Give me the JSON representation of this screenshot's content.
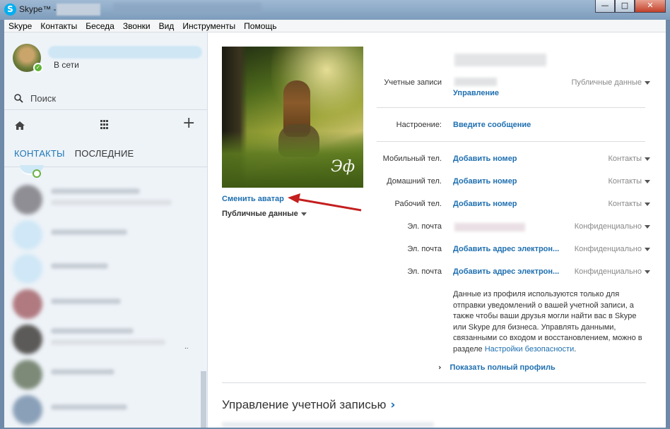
{
  "window": {
    "title": "Skype™ -",
    "logo_letter": "S",
    "controls": [
      "—",
      "□",
      "✕"
    ]
  },
  "menu": [
    "Skype",
    "Контакты",
    "Беседа",
    "Звонки",
    "Вид",
    "Инструменты",
    "Помощь"
  ],
  "sidebar": {
    "status": "В сети",
    "search_label": "Поиск",
    "tabs": [
      "КОНТАКТЫ",
      "ПОСЛЕДНИЕ"
    ],
    "active_tab": "КОНТАКТЫ",
    "more_dots": "..",
    "icons": [
      "home-icon",
      "dialpad-icon",
      "plus-icon",
      "search-icon"
    ]
  },
  "profile": {
    "photo_signature": "Эф",
    "change_avatar": "Сменить аватар",
    "public_data": "Публичные данные",
    "accounts": {
      "label": "Учетные записи",
      "manage": "Управление",
      "privacy": "Публичные данные"
    },
    "mood": {
      "label": "Настроение:",
      "value": "Введите сообщение"
    },
    "fields": [
      {
        "label": "Мобильный тел.",
        "value": "Добавить номер",
        "privacy": "Контакты"
      },
      {
        "label": "Домашний тел.",
        "value": "Добавить номер",
        "privacy": "Контакты"
      },
      {
        "label": "Рабочий тел.",
        "value": "Добавить номер",
        "privacy": "Контакты"
      },
      {
        "label": "Эл. почта",
        "value": "",
        "privacy": "Конфиденциально"
      },
      {
        "label": "Эл. почта",
        "value": "Добавить адрес электрон...",
        "privacy": "Конфиденциально"
      },
      {
        "label": "Эл. почта",
        "value": "Добавить адрес электрон...",
        "privacy": "Конфиденциально"
      }
    ],
    "note_text": "Данные из профиля используются только для отправки уведомлений о вашей учетной записи, а также чтобы ваши друзья могли найти вас в Skype или Skype для бизнеса. Управлять данными, связанными со входом и восстановлением, можно в разделе ",
    "note_link": "Настройки безопасности",
    "note_end": ".",
    "show_full": "Показать полный профиль",
    "chevron": "›",
    "section_title": "Управление учетной записью"
  },
  "colors": {
    "accent": "#1e6fb0",
    "online": "#5fb336",
    "annotation_arrow": "#c41e1e"
  }
}
